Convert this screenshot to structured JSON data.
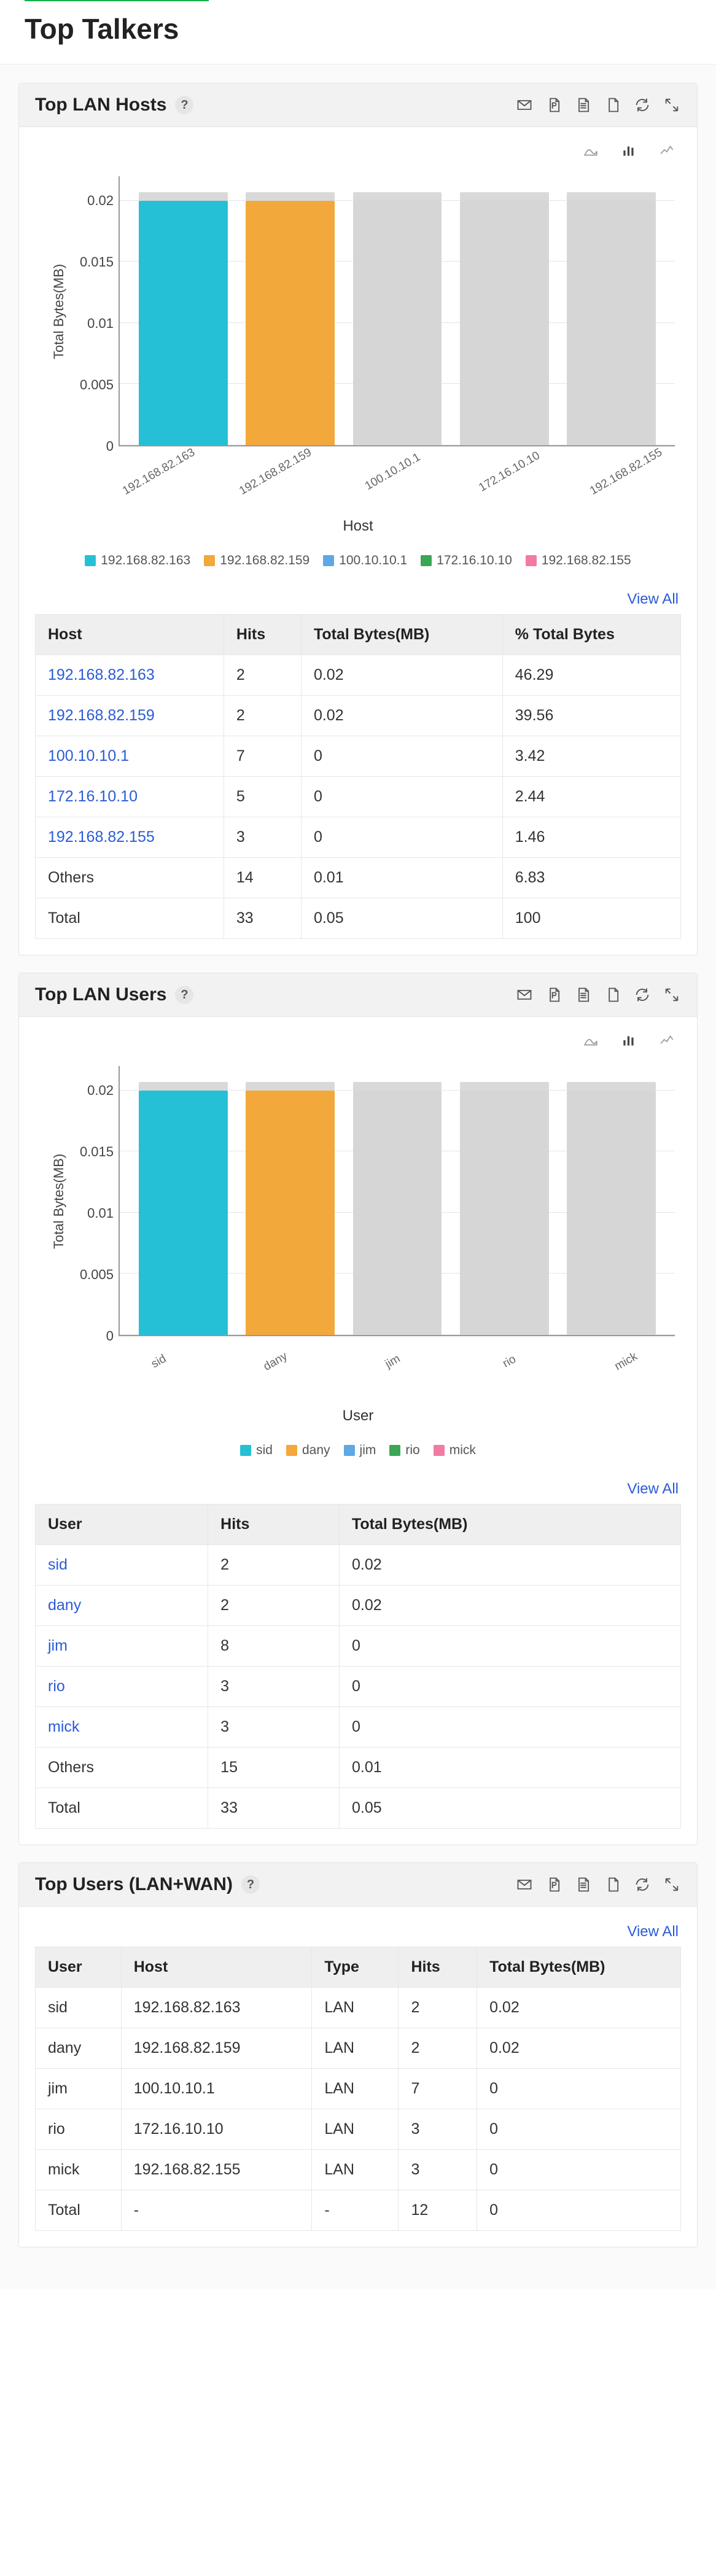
{
  "page": {
    "title": "Top Talkers"
  },
  "icons": {
    "email": "email-icon",
    "pdf": "pdf-icon",
    "csv": "csv-icon",
    "doc": "doc-icon",
    "refresh": "refresh-icon",
    "expand": "expand-icon"
  },
  "chart_colors": [
    "#26c0d6",
    "#f2a83b",
    "#5ea8e6",
    "#3aa757",
    "#f27ba3"
  ],
  "panels": [
    {
      "id": "lan_hosts",
      "title": "Top LAN Hosts",
      "help": "?",
      "view_all": "View All",
      "has_chart": true,
      "chart_type": "bar",
      "y_label": "Total Bytes(MB)",
      "x_label": "Host",
      "y_ticks": [
        0,
        0.005,
        0.01,
        0.015,
        0.02
      ],
      "y_max": 0.022,
      "chart_data": {
        "type": "bar",
        "title": "",
        "xlabel": "Host",
        "ylabel": "Total Bytes(MB)",
        "ylim": [
          0,
          0.022
        ],
        "categories": [
          "192.168.82.163",
          "192.168.82.159",
          "100.10.10.1",
          "172.16.10.10",
          "192.168.82.155"
        ],
        "values": [
          0.02,
          0.02,
          0.02,
          0.02,
          0.02
        ],
        "highlighted": [
          true,
          true,
          false,
          false,
          false
        ]
      },
      "table": {
        "columns": [
          "Host",
          "Hits",
          "Total Bytes(MB)",
          "% Total Bytes"
        ],
        "link_column": 0,
        "rows": [
          [
            "192.168.82.163",
            "2",
            "0.02",
            "46.29"
          ],
          [
            "192.168.82.159",
            "2",
            "0.02",
            "39.56"
          ],
          [
            "100.10.10.1",
            "7",
            "0",
            "3.42"
          ],
          [
            "172.16.10.10",
            "5",
            "0",
            "2.44"
          ],
          [
            "192.168.82.155",
            "3",
            "0",
            "1.46"
          ]
        ],
        "footer_rows": [
          [
            "Others",
            "14",
            "0.01",
            "6.83"
          ],
          [
            "Total",
            "33",
            "0.05",
            "100"
          ]
        ]
      }
    },
    {
      "id": "lan_users",
      "title": "Top LAN Users",
      "help": "?",
      "view_all": "View All",
      "has_chart": true,
      "chart_type": "bar",
      "y_label": "Total Bytes(MB)",
      "x_label": "User",
      "y_ticks": [
        0,
        0.005,
        0.01,
        0.015,
        0.02
      ],
      "y_max": 0.022,
      "chart_data": {
        "type": "bar",
        "title": "",
        "xlabel": "User",
        "ylabel": "Total Bytes(MB)",
        "ylim": [
          0,
          0.022
        ],
        "categories": [
          "sid",
          "dany",
          "jim",
          "rio",
          "mick"
        ],
        "values": [
          0.02,
          0.02,
          0.02,
          0.02,
          0.02
        ],
        "highlighted": [
          true,
          true,
          false,
          false,
          false
        ]
      },
      "table": {
        "columns": [
          "User",
          "Hits",
          "Total Bytes(MB)"
        ],
        "link_column": 0,
        "rows": [
          [
            "sid",
            "2",
            "0.02"
          ],
          [
            "dany",
            "2",
            "0.02"
          ],
          [
            "jim",
            "8",
            "0"
          ],
          [
            "rio",
            "3",
            "0"
          ],
          [
            "mick",
            "3",
            "0"
          ]
        ],
        "footer_rows": [
          [
            "Others",
            "15",
            "0.01"
          ],
          [
            "Total",
            "33",
            "0.05"
          ]
        ]
      }
    },
    {
      "id": "lan_wan_users",
      "title": "Top Users (LAN+WAN)",
      "help": "?",
      "view_all": "View All",
      "has_chart": false,
      "table": {
        "columns": [
          "User",
          "Host",
          "Type",
          "Hits",
          "Total Bytes(MB)"
        ],
        "link_column": -1,
        "rows": [
          [
            "sid",
            "192.168.82.163",
            "LAN",
            "2",
            "0.02"
          ],
          [
            "dany",
            "192.168.82.159",
            "LAN",
            "2",
            "0.02"
          ],
          [
            "jim",
            "100.10.10.1",
            "LAN",
            "7",
            "0"
          ],
          [
            "rio",
            "172.16.10.10",
            "LAN",
            "3",
            "0"
          ],
          [
            "mick",
            "192.168.82.155",
            "LAN",
            "3",
            "0"
          ]
        ],
        "footer_rows": [
          [
            "Total",
            "-",
            "-",
            "12",
            "0"
          ]
        ]
      }
    }
  ]
}
